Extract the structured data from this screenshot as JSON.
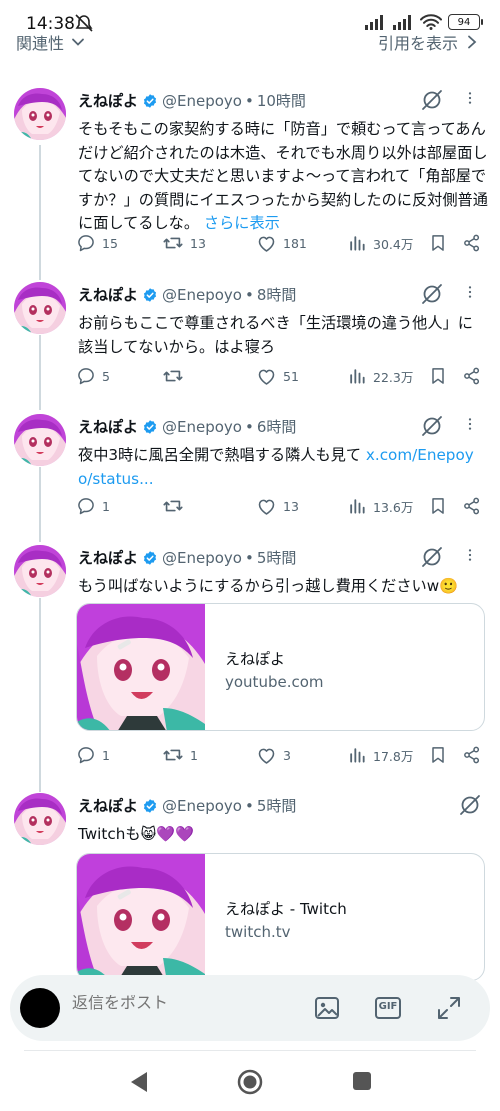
{
  "status_bar": {
    "time": "14:38",
    "battery": "94"
  },
  "subheader": {
    "sort_label": "関連性",
    "quote_label": "引用を表示"
  },
  "tweets": [
    {
      "name": "えねぽよ",
      "handle": "@Enepoyo",
      "time": "10時間",
      "text": "そもそもこの家契約する時に「防音」で頼むって言ってあんだけど紹介されたのは木造、それでも水周り以外は部屋面してないので大丈夫だと思いますよ〜って言われて「角部屋ですか？」の質問にイエスつったから契約したのに反対側普通に面してるしな。",
      "more": "さらに表示",
      "replies": "15",
      "retweets": "13",
      "likes": "181",
      "views": "30.4万"
    },
    {
      "name": "えねぽよ",
      "handle": "@Enepoyo",
      "time": "8時間",
      "text": "お前らもここで尊重されるべき「生活環境の違う他人」に該当してないから。はよ寝ろ",
      "replies": "5",
      "retweets": "",
      "likes": "51",
      "views": "22.3万"
    },
    {
      "name": "えねぽよ",
      "handle": "@Enepoyo",
      "time": "6時間",
      "text": "夜中3時に風呂全開で熱唱する隣人も見て",
      "link": "x.com/Enepoyo/status...",
      "replies": "1",
      "retweets": "",
      "likes": "13",
      "views": "13.6万"
    },
    {
      "name": "えねぽよ",
      "handle": "@Enepoyo",
      "time": "5時間",
      "text": "もう叫ばないようにするから引っ越し費用くださいw🙂",
      "card_title": "えねぽよ",
      "card_domain": "youtube.com",
      "replies": "1",
      "retweets": "1",
      "likes": "3",
      "views": "17.8万"
    },
    {
      "name": "えねぽよ",
      "handle": "@Enepoyo",
      "time": "5時間",
      "text": "Twitchも😸💜💜",
      "card_title": "えねぽよ - Twitch",
      "card_domain": "twitch.tv"
    }
  ],
  "reply_bar": {
    "placeholder": "返信をポスト",
    "gif_label": "GIF"
  },
  "colors": {
    "accent": "#1d9bf0",
    "secondary_text": "#536471",
    "thread_line": "#cfd9de",
    "card_border": "#cfd9de"
  },
  "icons": [
    "reply-icon",
    "retweet-icon",
    "like-icon",
    "views-icon",
    "bookmark-icon",
    "share-icon",
    "grok-icon",
    "more-icon",
    "verified-icon",
    "image-icon",
    "expand-icon"
  ]
}
